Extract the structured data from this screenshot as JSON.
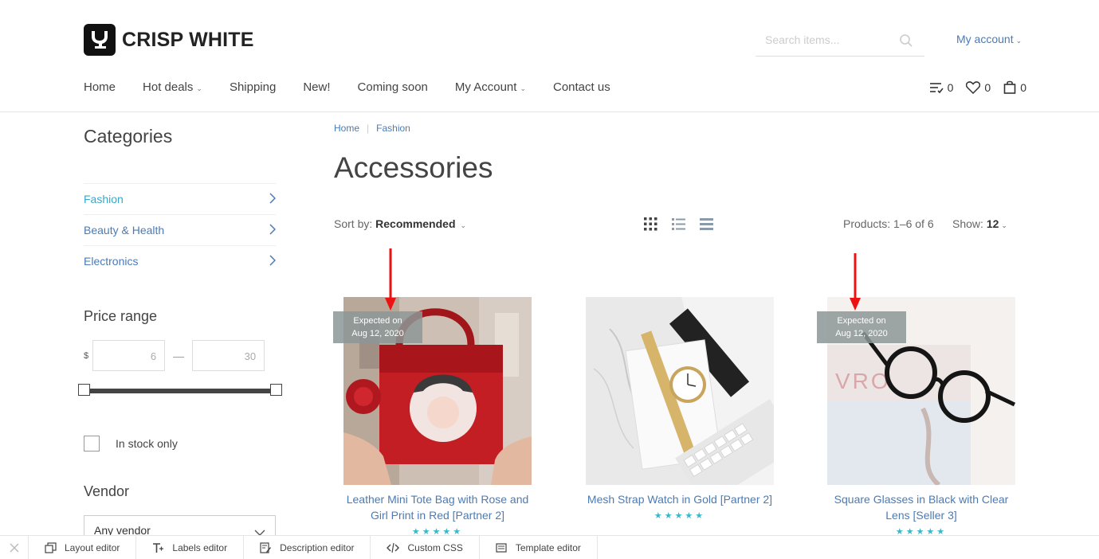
{
  "header": {
    "brand": "CRISP WHITE",
    "search_placeholder": "Search items...",
    "my_account": "My account",
    "nav": [
      "Home",
      "Hot deals",
      "Shipping",
      "New!",
      "Coming soon",
      "My Account",
      "Contact us"
    ],
    "compare_count": "0",
    "wishlist_count": "0",
    "cart_count": "0"
  },
  "sidebar": {
    "categories_title": "Categories",
    "categories": [
      "Fashion",
      "Beauty & Health",
      "Electronics"
    ],
    "price_title": "Price range",
    "currency": "$",
    "price_min": "6",
    "price_max": "30",
    "in_stock_label": "In stock only",
    "vendor_title": "Vendor",
    "vendor_value": "Any vendor"
  },
  "main": {
    "breadcrumb": [
      "Home",
      "Fashion"
    ],
    "title": "Accessories",
    "sort_label": "Sort by:",
    "sort_value": "Recommended",
    "products_count": "Products: 1–6 of 6",
    "show_label": "Show:",
    "show_value": "12",
    "products": [
      {
        "name": "Leather Mini Tote Bag with Rose and Girl Print in Red [Partner 2]",
        "badge_line1": "Expected on",
        "badge_line2": "Aug 12, 2020",
        "stars": "★★★★★"
      },
      {
        "name": "Mesh Strap Watch in Gold [Partner 2]",
        "stars": "★★★★★"
      },
      {
        "name": "Square Glasses in Black with Clear Lens [Seller 3]",
        "badge_line1": "Expected on",
        "badge_line2": "Aug 12, 2020",
        "stars": "★★★★★"
      }
    ]
  },
  "toolbar": {
    "layout_editor": "Layout editor",
    "labels_editor": "Labels editor",
    "description_editor": "Description editor",
    "custom_css": "Custom CSS",
    "template_editor": "Template editor"
  },
  "colors": {
    "link": "#4a7bb7",
    "active_category": "#3aa7c9",
    "annotation_arrow": "#ee1111"
  }
}
